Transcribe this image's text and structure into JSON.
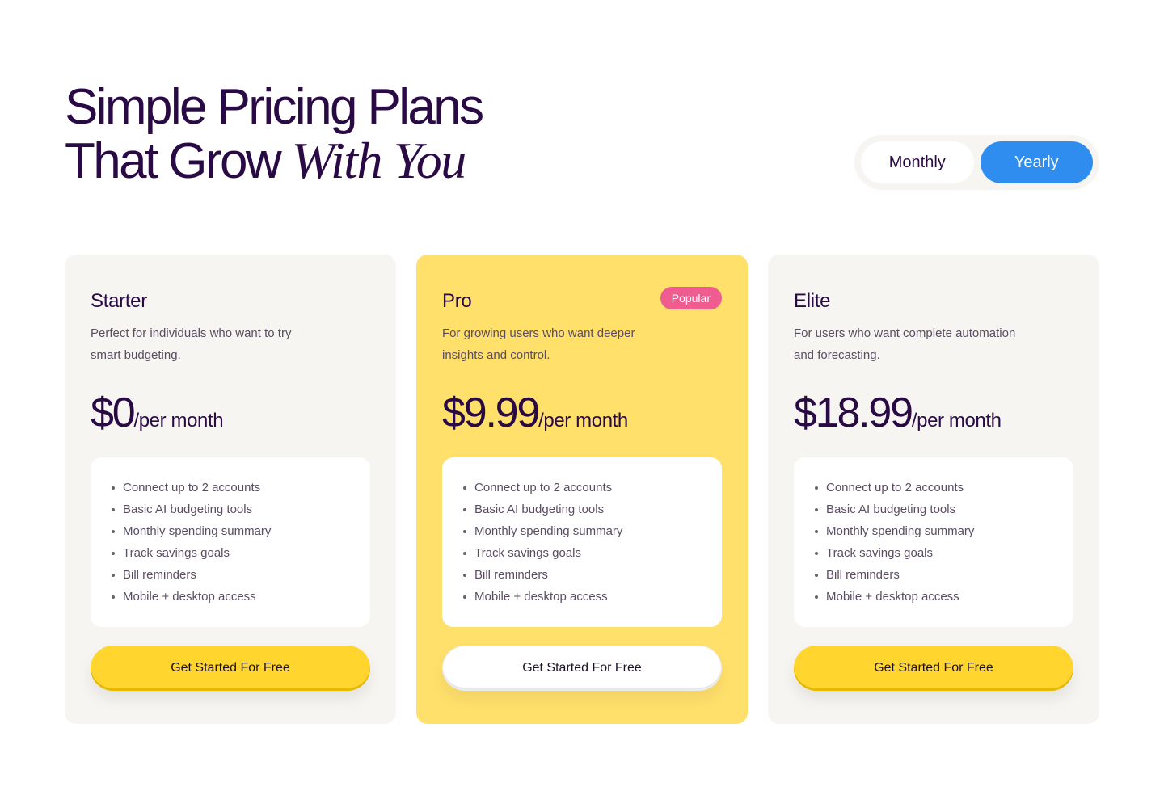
{
  "header": {
    "title_line1": "Simple Pricing Plans",
    "title_line2_plain": "That Grow",
    "title_line2_italic": "With You"
  },
  "billing_toggle": {
    "monthly_label": "Monthly",
    "yearly_label": "Yearly",
    "selected": "Yearly",
    "colors": {
      "selected_bg": "#2f8df0",
      "unselected_bg": "#ffffff"
    }
  },
  "plans": [
    {
      "name": "Starter",
      "description": "Perfect for individuals who want to try smart budgeting.",
      "price": "$0",
      "period": "/per month",
      "features": [
        "Connect up to 2 accounts",
        "Basic AI budgeting tools",
        "Monthly spending summary",
        "Track savings goals",
        "Bill reminders",
        "Mobile + desktop access"
      ],
      "cta_label": "Get Started For Free",
      "card_color": "#f6f5f1",
      "cta_color": "#ffd52e"
    },
    {
      "name": "Pro",
      "badge": "Popular",
      "description": "For growing users who want deeper insights and control.",
      "price": "$9.99",
      "period": "/per month",
      "features": [
        "Connect up to 2 accounts",
        "Basic AI budgeting tools",
        "Monthly spending summary",
        "Track savings goals",
        "Bill reminders",
        "Mobile + desktop access"
      ],
      "cta_label": "Get Started For Free",
      "card_color": "#ffe06b",
      "cta_color": "#ffffff",
      "badge_color": "#ef5d90"
    },
    {
      "name": "Elite",
      "description": "For users who want complete automation and forecasting.",
      "price": "$18.99",
      "period": "/per month",
      "features": [
        "Connect up to 2 accounts",
        "Basic AI budgeting tools",
        "Monthly spending summary",
        "Track savings goals",
        "Bill reminders",
        "Mobile + desktop access"
      ],
      "cta_label": "Get Started For Free",
      "card_color": "#f6f5f1",
      "cta_color": "#ffd52e"
    }
  ]
}
